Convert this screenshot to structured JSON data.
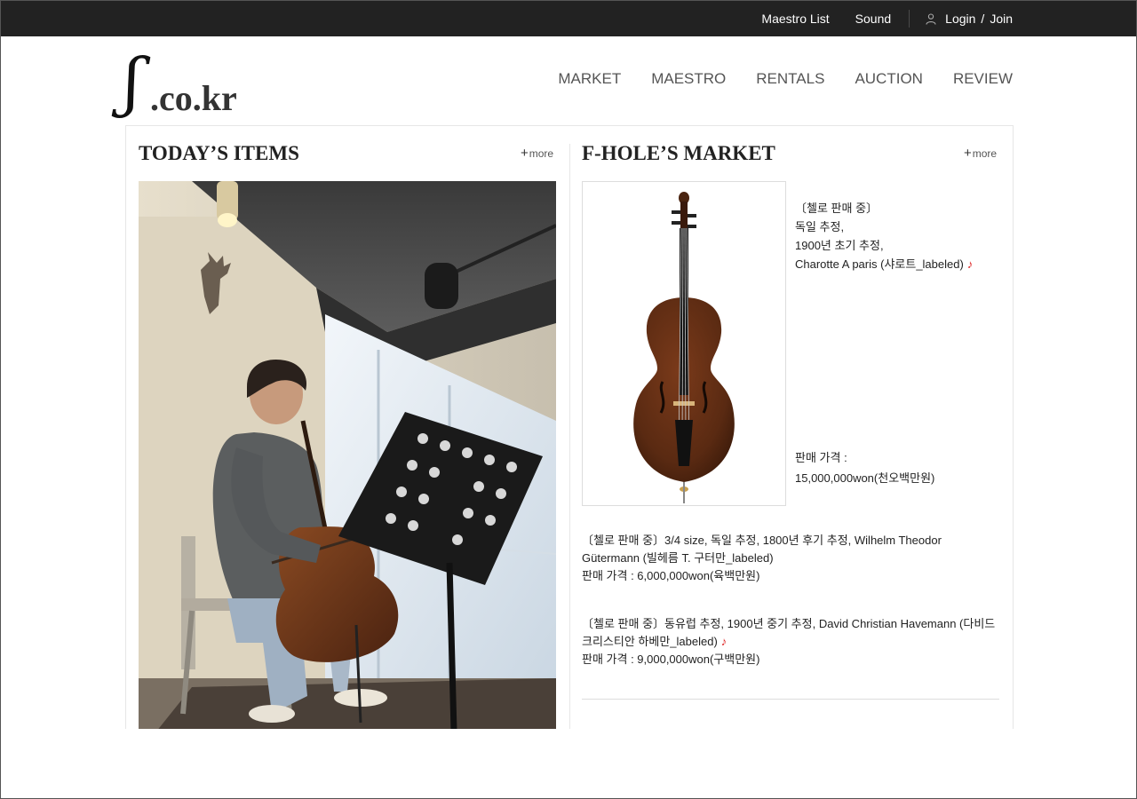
{
  "topbar": {
    "maestro_list": "Maestro List",
    "sound": "Sound",
    "login": "Login",
    "slash": "/",
    "join": "Join"
  },
  "logo": {
    "symbol": "ʃ",
    "text": ".co.kr"
  },
  "nav": [
    "MARKET",
    "MAESTRO",
    "RENTALS",
    "AUCTION",
    "REVIEW"
  ],
  "today_items": {
    "title": "TODAY’S ITEMS",
    "more": "more"
  },
  "market": {
    "title": "F-HOLE’S MARKET",
    "more": "more",
    "feature": {
      "lines": [
        "〔첼로 판매 중〕",
        "독일 추정,",
        "1900년 초기 추정,",
        "Charotte A paris (샤로트_labeled)"
      ],
      "price_label": "판매 가격 :",
      "price": "15,000,000won(천오백만원)"
    },
    "items": [
      {
        "text": "〔첼로 판매 중〕3/4 size, 독일 추정, 1800년 후기 추정, Wilhelm Theodor Gütermann (빌헤름 T. 구터만_labeled)",
        "price": "판매 가격 : 6,000,000won(육백만원)"
      },
      {
        "text": "〔첼로 판매 중〕동유럽 추정, 1900년 중기 추정, David Christian Havemann (다비드 크리스티안 하베만_labeled)",
        "price": "판매 가격 : 9,000,000won(구백만원)"
      }
    ]
  },
  "icons": {
    "user": "user-icon",
    "plus": "plus-icon",
    "note": "music-note-icon"
  },
  "colors": {
    "topbar": "#222222",
    "nav_text": "#555555",
    "note": "#dd2222"
  }
}
